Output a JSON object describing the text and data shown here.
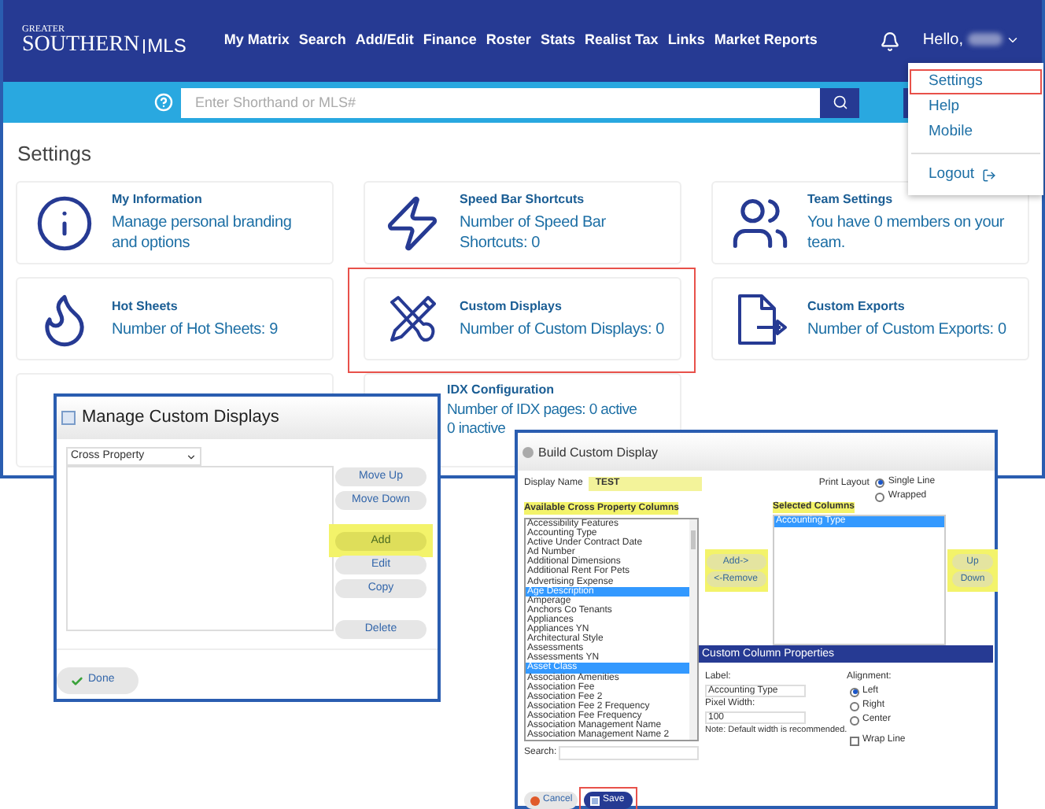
{
  "logo": {
    "top": "GREATER",
    "main": "SOUTHERN",
    "suffix": "MLS"
  },
  "nav": [
    "My Matrix",
    "Search",
    "Add/Edit",
    "Finance",
    "Roster",
    "Stats",
    "Realist Tax",
    "Links",
    "Market Reports"
  ],
  "user": {
    "greeting": "Hello,"
  },
  "user_menu": [
    {
      "label": "Settings",
      "kind": "item",
      "highlighted": true
    },
    {
      "label": "Help",
      "kind": "item",
      "highlighted": false
    },
    {
      "label": "Mobile",
      "kind": "item",
      "highlighted": false
    },
    {
      "label": "Logout",
      "kind": "logout",
      "highlighted": false
    }
  ],
  "search": {
    "placeholder": "Enter Shorthand or MLS#"
  },
  "page_title": "Settings",
  "cards": [
    {
      "title": "My Information",
      "lines": [
        "Manage personal branding",
        "and options"
      ],
      "kind": "info",
      "highlighted": false
    },
    {
      "title": "Speed Bar Shortcuts",
      "lines": [
        "Number of Speed Bar",
        "Shortcuts: 0"
      ],
      "kind": "bolt",
      "highlighted": false
    },
    {
      "title": "Team Settings",
      "lines": [
        "You have 0 members on your",
        "team."
      ],
      "kind": "team",
      "highlighted": false
    },
    {
      "title": "Hot Sheets",
      "lines": [
        "Number of Hot Sheets: 9"
      ],
      "kind": "flame",
      "highlighted": false
    },
    {
      "title": "Custom Displays",
      "lines": [
        "Number of Custom Displays: 0"
      ],
      "kind": "tools",
      "highlighted": true
    },
    {
      "title": "Custom Exports",
      "lines": [
        "Number of Custom Exports: 0"
      ],
      "kind": "export",
      "highlighted": false
    },
    {
      "title": "IDX Configuration",
      "lines": [
        "Number of IDX pages: 0 active",
        "0 inactive"
      ],
      "kind": "none",
      "highlighted": false
    }
  ],
  "manage_dialog": {
    "title": "Manage Custom Displays",
    "select": "Cross Property",
    "buttons": [
      {
        "label": "Move Up",
        "kind": "order",
        "highlighted": false
      },
      {
        "label": "Move Down",
        "kind": "order",
        "highlighted": false
      },
      {
        "label": "Add",
        "kind": "edit",
        "highlighted": true
      },
      {
        "label": "Edit",
        "kind": "edit",
        "highlighted": false
      },
      {
        "label": "Copy",
        "kind": "edit",
        "highlighted": false
      },
      {
        "label": "Delete",
        "kind": "delete",
        "highlighted": false
      }
    ],
    "done": "Done"
  },
  "build_dialog": {
    "title": "Build Custom Display",
    "display_name": {
      "label": "Display Name",
      "value": "TEST",
      "highlighted": true
    },
    "print_layout": {
      "label": "Print Layout",
      "options": [
        {
          "label": "Single Line",
          "selected": true
        },
        {
          "label": "Wrapped",
          "selected": false
        }
      ]
    },
    "available": {
      "heading": "Available Cross Property Columns",
      "highlighted": true,
      "items": [
        {
          "label": "Accessibility Features",
          "selected": false
        },
        {
          "label": "Accounting Type",
          "selected": false
        },
        {
          "label": "Active Under Contract Date",
          "selected": false
        },
        {
          "label": "Ad Number",
          "selected": false
        },
        {
          "label": "Additional Dimensions",
          "selected": false
        },
        {
          "label": "Additional Rent For Pets",
          "selected": false
        },
        {
          "label": "Advertising Expense",
          "selected": false
        },
        {
          "label": "Age Description",
          "selected": true
        },
        {
          "label": "Amperage",
          "selected": false
        },
        {
          "label": "Anchors Co Tenants",
          "selected": false
        },
        {
          "label": "Appliances",
          "selected": false
        },
        {
          "label": "Appliances YN",
          "selected": false
        },
        {
          "label": "Architectural Style",
          "selected": false
        },
        {
          "label": "Assessments",
          "selected": false
        },
        {
          "label": "Assessments YN",
          "selected": false
        },
        {
          "label": "Asset Class",
          "selected": true
        },
        {
          "label": "Association Amenities",
          "selected": false
        },
        {
          "label": "Association Fee",
          "selected": false
        },
        {
          "label": "Association Fee 2",
          "selected": false
        },
        {
          "label": "Association Fee 2 Frequency",
          "selected": false
        },
        {
          "label": "Association Fee Frequency",
          "selected": false
        },
        {
          "label": "Association Management Name",
          "selected": false
        },
        {
          "label": "Association Management Name 2",
          "selected": false
        }
      ]
    },
    "transfer": {
      "highlighted": true,
      "buttons": [
        "Add->",
        "<-Remove"
      ]
    },
    "selected_columns": {
      "heading": "Selected Columns",
      "highlighted": true,
      "items": [
        {
          "label": "Accounting Type",
          "selected": true
        }
      ]
    },
    "order": {
      "highlighted": true,
      "buttons": [
        "Up",
        "Down"
      ]
    },
    "properties": {
      "heading": "Custom Column Properties",
      "label_field": {
        "label": "Label:",
        "value": "Accounting Type"
      },
      "width_field": {
        "label": "Pixel Width:",
        "value": "100"
      },
      "note": "Note: Default width is recommended.",
      "alignment": {
        "label": "Alignment:",
        "options": [
          {
            "label": "Left",
            "selected": true
          },
          {
            "label": "Right",
            "selected": false
          },
          {
            "label": "Center",
            "selected": false
          }
        ]
      },
      "wrap_line": {
        "label": "Wrap Line",
        "checked": false
      }
    },
    "search": {
      "label": "Search:"
    },
    "cancel": "Cancel",
    "save": {
      "label": "Save",
      "highlighted": true
    }
  }
}
